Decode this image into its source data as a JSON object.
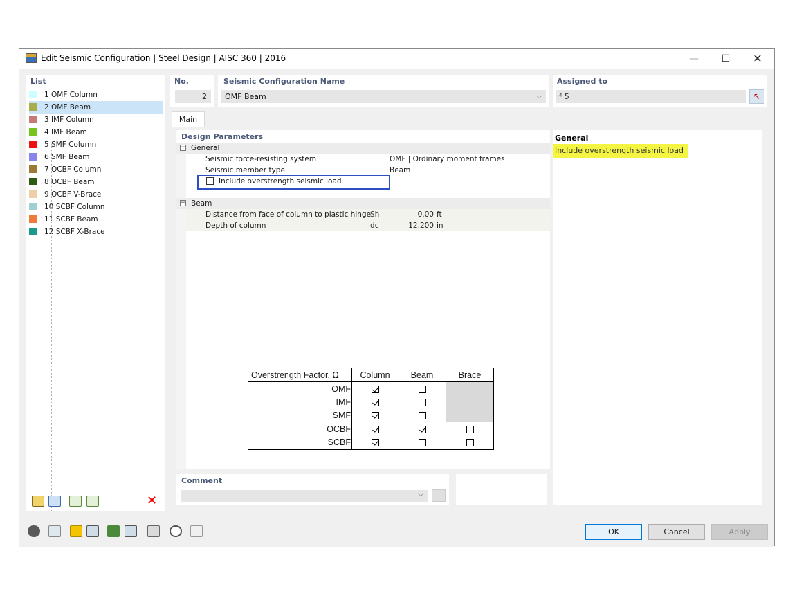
{
  "window": {
    "title": "Edit Seismic Configuration | Steel Design | AISC 360 | 2016",
    "min": "—",
    "max": "☐",
    "close": "✕"
  },
  "list": {
    "header": "List",
    "items": [
      {
        "label": "1 OMF Column",
        "color": "#ccffff"
      },
      {
        "label": "2 OMF Beam",
        "color": "#a7ad4a"
      },
      {
        "label": "3 IMF Column",
        "color": "#c77a7a"
      },
      {
        "label": "4 IMF Beam",
        "color": "#77c41c"
      },
      {
        "label": "5 SMF Column",
        "color": "#ee1111"
      },
      {
        "label": "6 SMF Beam",
        "color": "#8686ee"
      },
      {
        "label": "7 OCBF Column",
        "color": "#9b7a36"
      },
      {
        "label": "8 OCBF Beam",
        "color": "#2f5a14"
      },
      {
        "label": "9 OCBF V-Brace",
        "color": "#efcfa7"
      },
      {
        "label": "10 SCBF Column",
        "color": "#9fcfcf"
      },
      {
        "label": "11 SCBF Beam",
        "color": "#ef7a3a"
      },
      {
        "label": "12 SCBF X-Brace",
        "color": "#1a9a8a"
      }
    ],
    "delete_label": "✕"
  },
  "header": {
    "no_label": "No.",
    "no_value": "2",
    "name_label": "Seismic Configuration Name",
    "name_value": "OMF Beam",
    "dropdown_arrow": "⌵",
    "assigned_label": "Assigned to",
    "assigned_value": "⁴ 5",
    "pick_glyph": "↖"
  },
  "tabs": {
    "main": "Main"
  },
  "params": {
    "title": "Design Parameters",
    "general": {
      "label": "General",
      "rows": [
        {
          "name": "Seismic force-resisting system",
          "value": "OMF | Ordinary moment frames"
        },
        {
          "name": "Seismic member type",
          "value": "Beam"
        },
        {
          "name": "Include overstrength seismic load",
          "checked": false
        }
      ]
    },
    "beam": {
      "label": "Beam",
      "rows": [
        {
          "name": "Distance from face of column to plastic hinge",
          "symbol": "Sh",
          "value": "0.00",
          "unit": "ft"
        },
        {
          "name": "Depth of column",
          "symbol": "dc",
          "value": "12.200",
          "unit": "in"
        }
      ]
    },
    "expander_minus": "−"
  },
  "overstrength_table": {
    "headers": [
      "Overstrength Factor, Ω",
      "Column",
      "Beam",
      "Brace"
    ],
    "rows": [
      {
        "label": "OMF",
        "column": true,
        "beam": false,
        "brace": null
      },
      {
        "label": "IMF",
        "column": true,
        "beam": false,
        "brace": null
      },
      {
        "label": "SMF",
        "column": true,
        "beam": false,
        "brace": null
      },
      {
        "label": "OCBF",
        "column": true,
        "beam": true,
        "brace": false
      },
      {
        "label": "SCBF",
        "column": true,
        "beam": false,
        "brace": false
      }
    ]
  },
  "info": {
    "title": "General",
    "highlight": "Include overstrength seismic load",
    "highlight_color": "#f4f442"
  },
  "comment": {
    "label": "Comment",
    "value": ""
  },
  "buttons": {
    "ok": "OK",
    "cancel": "Cancel",
    "apply": "Apply"
  }
}
